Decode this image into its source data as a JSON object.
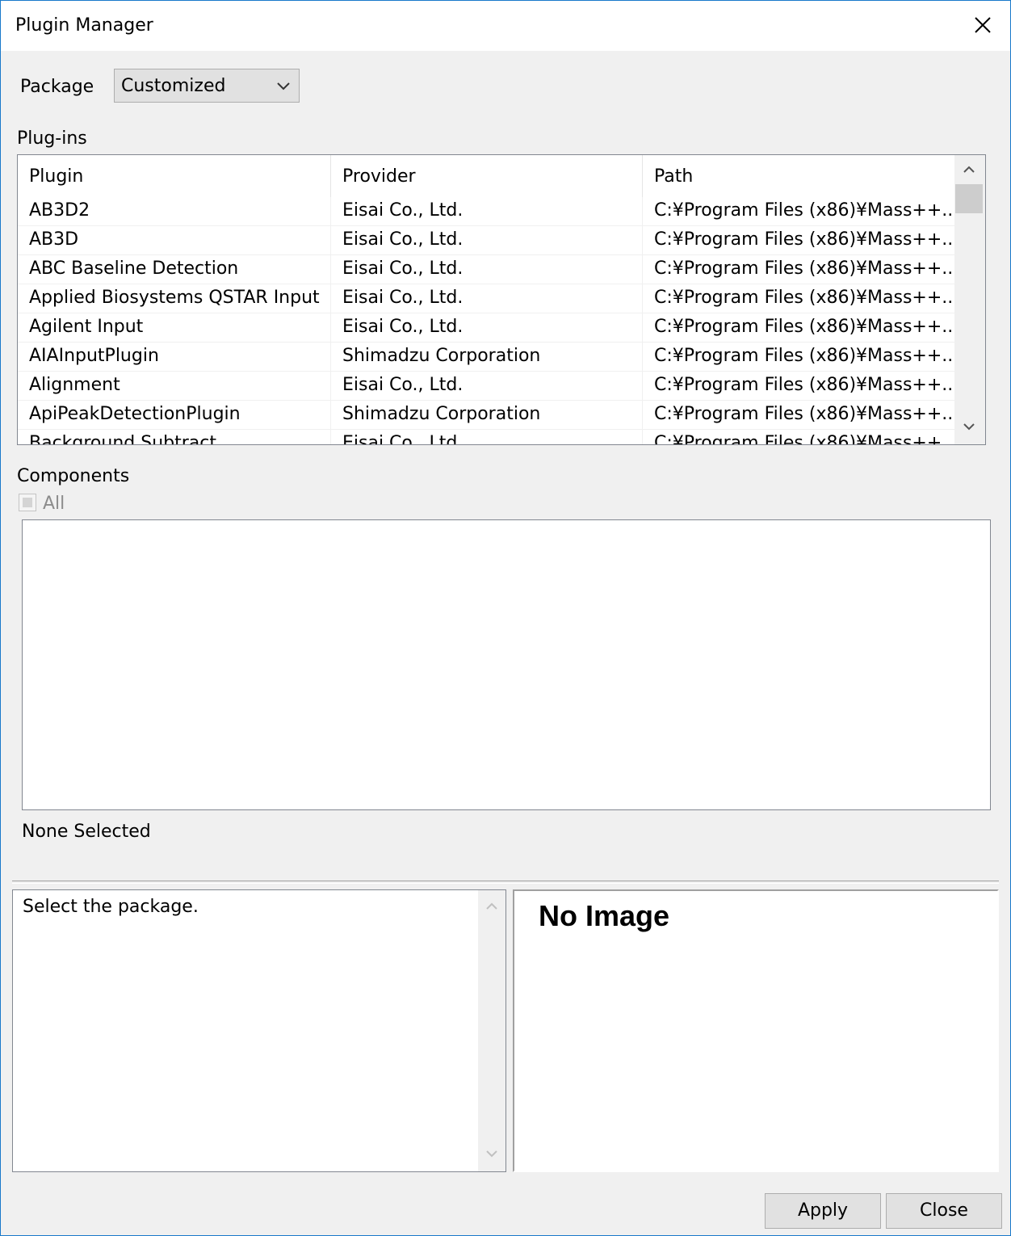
{
  "window": {
    "title": "Plugin Manager"
  },
  "package": {
    "label": "Package",
    "selected": "Customized"
  },
  "plugins": {
    "label": "Plug-ins",
    "columns": [
      "Plugin",
      "Provider",
      "Path"
    ],
    "rows": [
      [
        "AB3D2",
        "Eisai Co., Ltd.",
        "C:¥Program Files (x86)¥Mass++..."
      ],
      [
        "AB3D",
        "Eisai Co., Ltd.",
        "C:¥Program Files (x86)¥Mass++..."
      ],
      [
        "ABC Baseline Detection",
        "Eisai Co., Ltd.",
        "C:¥Program Files (x86)¥Mass++..."
      ],
      [
        "Applied Biosystems QSTAR Input",
        "Eisai Co., Ltd.",
        "C:¥Program Files (x86)¥Mass++..."
      ],
      [
        "Agilent Input",
        "Eisai Co., Ltd.",
        "C:¥Program Files (x86)¥Mass++..."
      ],
      [
        "AIAInputPlugin",
        "Shimadzu Corporation",
        "C:¥Program Files (x86)¥Mass++..."
      ],
      [
        "Alignment",
        "Eisai Co., Ltd.",
        "C:¥Program Files (x86)¥Mass++..."
      ],
      [
        "ApiPeakDetectionPlugin",
        "Shimadzu Corporation",
        "C:¥Program Files (x86)¥Mass++..."
      ],
      [
        "Background Subtract",
        "Eisai Co., Ltd.",
        "C:¥Program Files (x86)¥Mass++..."
      ]
    ]
  },
  "components": {
    "label": "Components",
    "all_label": "All",
    "status": "None Selected"
  },
  "description": {
    "text": "Select the package."
  },
  "image": {
    "placeholder": "No Image"
  },
  "buttons": {
    "apply": "Apply",
    "close": "Close"
  }
}
